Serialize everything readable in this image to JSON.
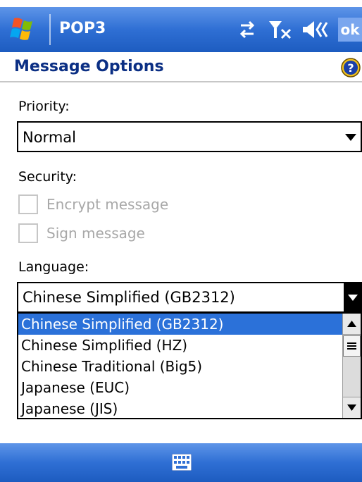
{
  "title_bar": {
    "app_title": "POP3",
    "ok_label": "ok",
    "icons": [
      "windows-start-icon",
      "connectivity-icon",
      "signal-off-icon",
      "volume-icon"
    ]
  },
  "header": {
    "title": "Message Options",
    "help_icon": "help-icon"
  },
  "priority": {
    "label": "Priority:",
    "value": "Normal"
  },
  "security": {
    "label": "Security:",
    "encrypt_label": "Encrypt message",
    "sign_label": "Sign message"
  },
  "language": {
    "label": "Language:",
    "value": "Chinese Simplified (GB2312)",
    "options": [
      "Chinese Simplified (GB2312)",
      "Chinese Simplified (HZ)",
      "Chinese Traditional (Big5)",
      "Japanese (EUC)",
      "Japanese (JIS)"
    ],
    "selected_index": 0
  },
  "bottom_bar": {
    "icon": "keyboard-icon"
  },
  "colors": {
    "title_bar": "#2f6fd4",
    "header_text": "#0b2f84",
    "selection": "#2b71d9"
  }
}
